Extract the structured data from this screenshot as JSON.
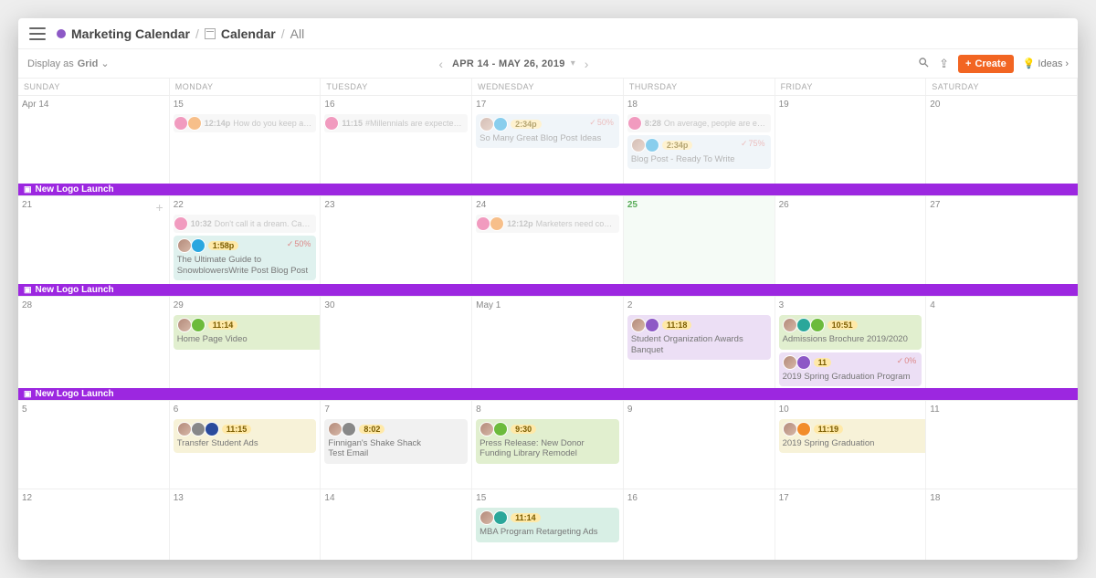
{
  "breadcrumb": {
    "folder": "Marketing Calendar",
    "section": "Calendar",
    "filter": "All"
  },
  "toolbar": {
    "display_as_label": "Display as",
    "display_as_value": "Grid",
    "range": "APR 14 - MAY 26, 2019",
    "create_label": "Create",
    "ideas_label": "Ideas"
  },
  "dow": [
    "Sunday",
    "Monday",
    "Tuesday",
    "Wednesday",
    "Thursday",
    "Friday",
    "Saturday"
  ],
  "campaign_bars": [
    "New Logo Launch",
    "New Logo Launch",
    "New Logo Launch"
  ],
  "weeks": [
    {
      "days": [
        {
          "label": "Apr 14"
        },
        {
          "label": "15",
          "minis": [
            {
              "chips": [
                "pink",
                "orange"
              ],
              "time": "12:14p",
              "text": "How do you keep a pu…"
            }
          ]
        },
        {
          "label": "16",
          "minis": [
            {
              "chips": [
                "pink"
              ],
              "time": "11:15",
              "text": "#Millennials are expecte…"
            }
          ]
        },
        {
          "label": "17",
          "cards": [
            {
              "bg": "bg-blue",
              "avatar": true,
              "chips": [
                "blue"
              ],
              "time": "2:34p",
              "prog": "50%",
              "title": "So Many Great Blog Post Ideas"
            }
          ]
        },
        {
          "label": "18",
          "minis": [
            {
              "chips": [
                "pink"
              ],
              "time": "8:28",
              "text": "On average, people are e…"
            }
          ],
          "cards": [
            {
              "bg": "bg-blue",
              "avatar": true,
              "chips": [
                "blue"
              ],
              "time": "2:34p",
              "prog": "75%",
              "title": "Blog Post - Ready To Write"
            }
          ]
        },
        {
          "label": "19"
        },
        {
          "label": "20"
        }
      ]
    },
    {
      "days": [
        {
          "label": "21",
          "hover": true
        },
        {
          "label": "22",
          "minis": [
            {
              "chips": [
                "pink"
              ],
              "time": "10:32",
              "text": "Don't call it a dream. Ca…"
            }
          ],
          "cards": [
            {
              "bg": "bg-teal",
              "avatar": true,
              "chips": [
                "blue"
              ],
              "time": "1:58p",
              "prog": "50%",
              "title": "The Ultimate Guide to SnowblowersWrite Post Blog Post"
            }
          ]
        },
        {
          "label": "23"
        },
        {
          "label": "24",
          "minis": [
            {
              "chips": [
                "pink",
                "orange"
              ],
              "time": "12:12p",
              "text": "Marketers need consis…"
            }
          ]
        },
        {
          "label": "25",
          "today": true
        },
        {
          "label": "26"
        },
        {
          "label": "27"
        }
      ]
    },
    {
      "days": [
        {
          "label": "28"
        },
        {
          "label": "29",
          "cards": [
            {
              "bg": "bg-green",
              "avatar": true,
              "chips": [
                "green"
              ],
              "time": "11:14",
              "title": "Home Page Video",
              "wide": 2
            }
          ]
        },
        {
          "label": "30"
        },
        {
          "label": "May 1"
        },
        {
          "label": "2",
          "cards": [
            {
              "bg": "bg-lav",
              "avatar": true,
              "chips": [
                "purple"
              ],
              "time": "11:18",
              "title": "Student Organization Awards Banquet"
            }
          ]
        },
        {
          "label": "3",
          "cards": [
            {
              "bg": "bg-green",
              "avatar": true,
              "chips": [
                "teal",
                "green"
              ],
              "time": "10:51",
              "title": "Admissions Brochure 2019/2020"
            },
            {
              "bg": "bg-lav",
              "avatar": true,
              "chips": [
                "purple"
              ],
              "time": "11",
              "prog": "0%",
              "title": "2019 Spring Graduation Program"
            }
          ]
        },
        {
          "label": "4"
        }
      ]
    },
    {
      "days": [
        {
          "label": "5"
        },
        {
          "label": "6",
          "cards": [
            {
              "bg": "bg-yellow",
              "avatar": true,
              "chips": [
                "grey",
                "navy"
              ],
              "time": "11:15",
              "title": "Transfer Student Ads"
            }
          ]
        },
        {
          "label": "7",
          "cards": [
            {
              "bg": "bg-grey",
              "avatar": true,
              "chips": [
                "grey"
              ],
              "time": "8:02",
              "title": "Finnigan's Shake Shack\nTest Email"
            }
          ]
        },
        {
          "label": "8",
          "cards": [
            {
              "bg": "bg-green",
              "avatar": true,
              "chips": [
                "green"
              ],
              "time": "9:30",
              "title": "Press Release: New Donor Funding Library Remodel"
            }
          ]
        },
        {
          "label": "9"
        },
        {
          "label": "10",
          "cards": [
            {
              "bg": "bg-yellow",
              "avatar": true,
              "chips": [
                "orange"
              ],
              "time": "11:19",
              "title": "2019 Spring Graduation",
              "wide": 2
            }
          ]
        },
        {
          "label": "11"
        }
      ]
    },
    {
      "days": [
        {
          "label": "12"
        },
        {
          "label": "13"
        },
        {
          "label": "14"
        },
        {
          "label": "15",
          "cards": [
            {
              "bg": "bg-mint",
              "avatar": true,
              "chips": [
                "teal"
              ],
              "time": "11:14",
              "title": "MBA Program Retargeting Ads"
            }
          ]
        },
        {
          "label": "16"
        },
        {
          "label": "17"
        },
        {
          "label": "18"
        }
      ]
    }
  ]
}
